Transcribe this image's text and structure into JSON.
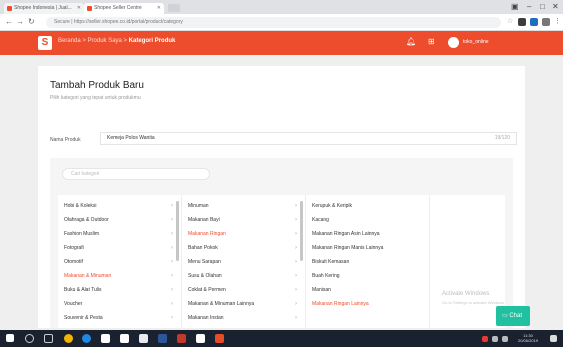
{
  "browser": {
    "tabs": [
      {
        "label": "Shopee Indonesia | Jual..."
      },
      {
        "label": "Shopee Seller Centre"
      }
    ],
    "url": "Secure | https://seller.shopee.co.id/portal/product/category"
  },
  "header": {
    "breadcrumb_prefix": "Beranda > Produk Saya > ",
    "breadcrumb_current": "Kategori Produk",
    "username": "toko_online"
  },
  "page": {
    "title": "Tambah Produk Baru",
    "subtitle": "Pilih kategori yang tepat untuk produkmu",
    "name_label": "Nama Produk",
    "name_value": "Kemeja Polos Wanita",
    "name_counter": "19/120",
    "search_placeholder": "Cari kategori"
  },
  "categories": {
    "col1": [
      "Hobi & Koleksi",
      "Olahraga & Outdoor",
      "Fashion Muslim",
      "Fotografi",
      "Otomotif",
      "Makanan & Minuman",
      "Buku & Alat Tulis",
      "Voucher",
      "Souvenir & Pesta"
    ],
    "col2": [
      "Minuman",
      "Makanan Bayi",
      "Makanan Ringan",
      "Bahan Pokok",
      "Menu Sarapan",
      "Susu & Olahan",
      "Coklat & Permen",
      "Makanan & Minuman Lainnya",
      "Makanan Instan"
    ],
    "col3": [
      "Kerupuk & Keripik",
      "Kacang",
      "Makanan Ringan Asin Lainnya",
      "Makanan Ringan Manis Lainnya",
      "Biskuit Kemasan",
      "Buah Kering",
      "Manisan",
      "Makanan Ringan Lainnya"
    ],
    "selected_col1": 5,
    "selected_col2": 2,
    "selected_col3": 7
  },
  "watermark": {
    "line1": "Activate Windows",
    "line2": "Go to Settings to activate Windows."
  },
  "chat": {
    "label": "Chat"
  },
  "taskbar": {
    "time": "11:30",
    "date": "20/06/2019"
  },
  "colors": {
    "brand": "#ee4d2d",
    "chat": "#20c0a0",
    "taskbar": "#1a2230"
  }
}
